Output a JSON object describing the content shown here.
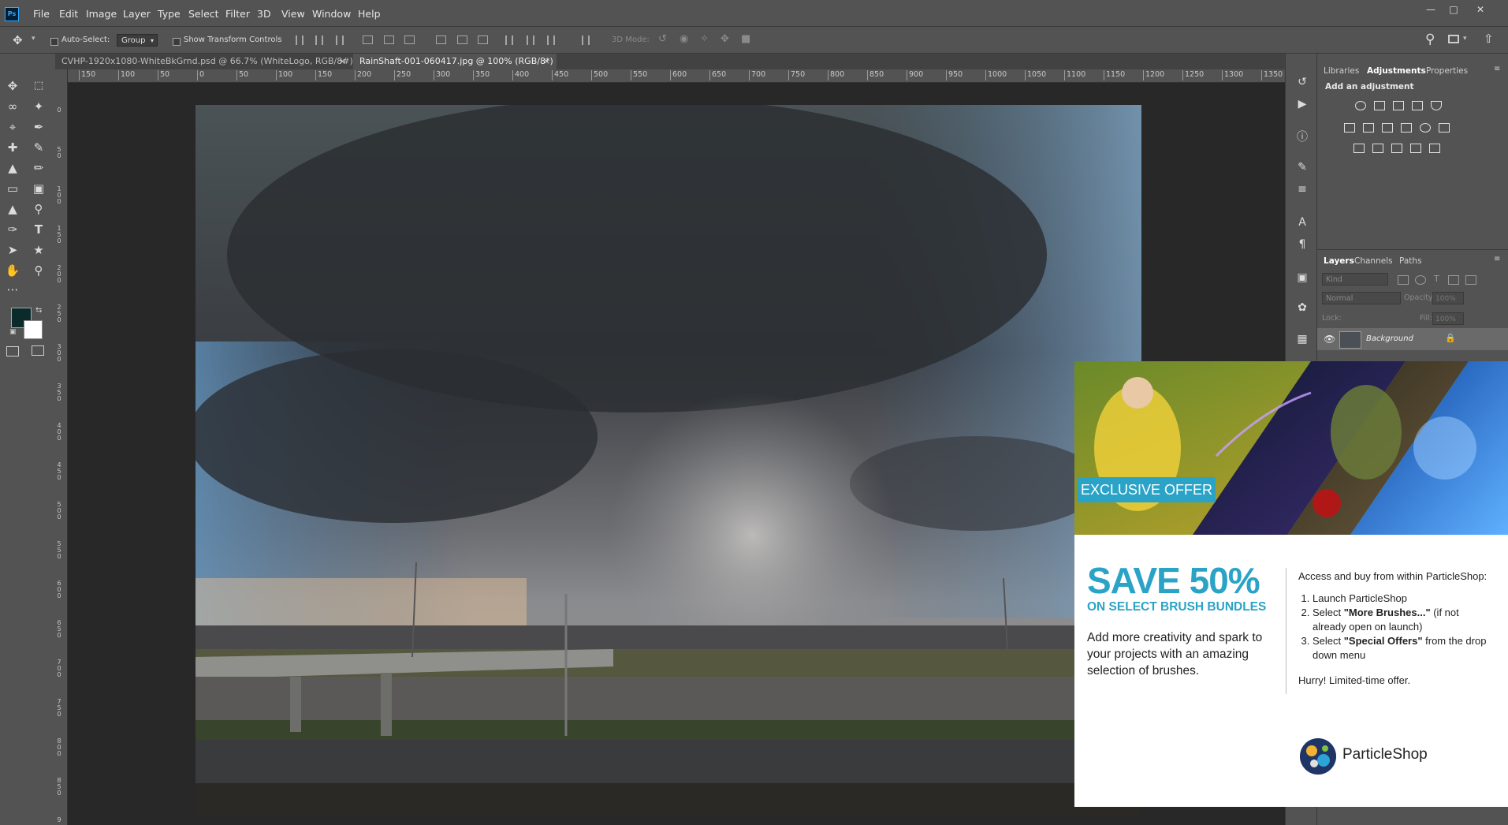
{
  "app": {
    "logo_text": "Ps"
  },
  "menu": [
    "File",
    "Edit",
    "Image",
    "Layer",
    "Type",
    "Select",
    "Filter",
    "3D",
    "View",
    "Window",
    "Help"
  ],
  "options_bar": {
    "auto_select_label": "Auto-Select:",
    "auto_select_value": "Group",
    "show_transform_label": "Show Transform Controls",
    "mode_label": "3D Mode:"
  },
  "tabs": [
    {
      "label": "CVHP-1920x1080-WhiteBkGrnd.psd @ 66.7% (WhiteLogo, RGB/8#)",
      "active": false
    },
    {
      "label": "RainShaft-001-060417.jpg @ 100% (RGB/8*)",
      "active": true
    }
  ],
  "ruler_top_ticks": [
    "150",
    "100",
    "50",
    "0",
    "50",
    "100",
    "150",
    "200",
    "250",
    "300",
    "350",
    "400",
    "450",
    "500",
    "550",
    "600",
    "650",
    "700",
    "750",
    "800",
    "850",
    "900",
    "950",
    "1000",
    "1050",
    "1100",
    "1150",
    "1200",
    "1250",
    "1300",
    "1350"
  ],
  "ruler_left_ticks": [
    "0",
    "5 0",
    "1 0 0",
    "1 5 0",
    "2 0 0",
    "2 5 0",
    "3 0 0",
    "3 5 0",
    "4 0 0",
    "4 5 0",
    "5 0 0",
    "5 5 0",
    "6 0 0",
    "6 5 0",
    "7 0 0",
    "7 5 0",
    "8 0 0",
    "8 5 0",
    "9"
  ],
  "colors": {
    "foreground": "#0b2a2a",
    "background": "#ffffff",
    "accent": "#2aa3c6"
  },
  "panels": {
    "top_tabs": [
      "Libraries",
      "Adjustments",
      "Properties"
    ],
    "adjustments_heading": "Add an adjustment",
    "layers_tabs": [
      "Layers",
      "Channels",
      "Paths"
    ],
    "kind_placeholder": "Kind",
    "blend_mode": "Normal",
    "opacity_label": "Opacity:",
    "opacity_value": "100%",
    "lock_label": "Lock:",
    "fill_label": "Fill:",
    "fill_value": "100%",
    "layer_name": "Background"
  },
  "ad": {
    "badge": "EXCLUSIVE OFFER",
    "headline": "SAVE 50%",
    "subheadline": "ON SELECT BRUSH BUNDLES",
    "description": "Add more creativity and spark to your projects with an amazing selection of brushes.",
    "intro": "Access and buy from within ParticleShop:",
    "steps": [
      {
        "before": "Launch ParticleShop",
        "bold": "",
        "after": ""
      },
      {
        "before": "Select ",
        "bold": "\"More Brushes...\"",
        "after": " (if not already open on launch)"
      },
      {
        "before": "Select ",
        "bold": "\"Special Offers\"",
        "after": " from the drop down menu"
      }
    ],
    "closing": "Hurry! Limited-time offer.",
    "brand": "ParticleShop"
  }
}
